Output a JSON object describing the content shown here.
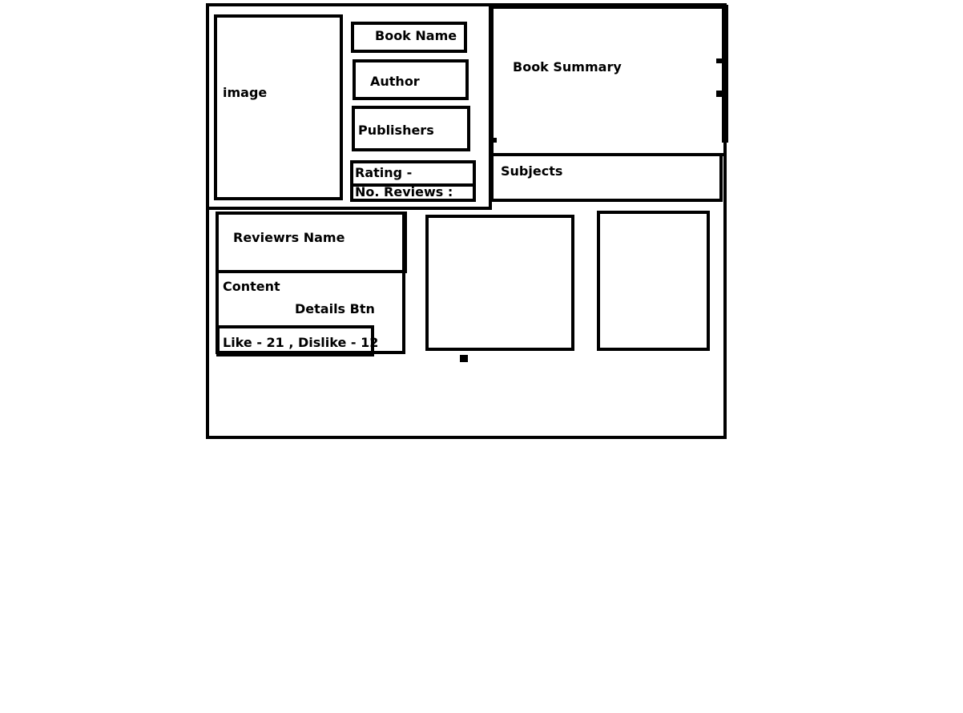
{
  "book": {
    "image_label": "image",
    "name_label": "Book Name",
    "author_label": "Author",
    "publishers_label": "Publishers",
    "rating_label": "Rating -",
    "reviews_count_label": "No. Reviews :",
    "summary_label": "Book Summary",
    "subjects_label": "Subjects"
  },
  "reviews": [
    {
      "reviewer_label": "Reviewrs Name",
      "content_label": "Content",
      "details_button_label": "Details Btn",
      "likes_label": "Like - 21 , Dislike - 12"
    }
  ]
}
